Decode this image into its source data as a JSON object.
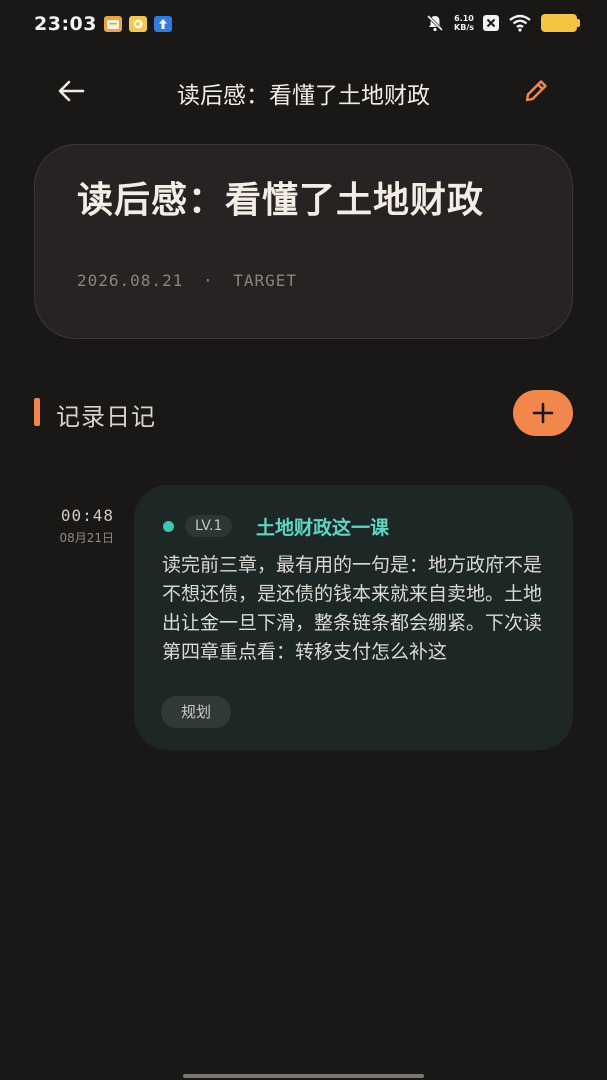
{
  "status_bar": {
    "time": "23:03",
    "net_speed_value": "6.10",
    "net_speed_unit": "KB/s",
    "icons": [
      "app-notif-orange",
      "app-notif-yellow",
      "app-notif-blue-upload",
      "mute-bell",
      "x-icon",
      "wifi",
      "battery"
    ],
    "battery_color": "#f5c542"
  },
  "app_bar": {
    "title": "读后感：看懂了土地财政",
    "back_icon": "arrow-left",
    "edit_icon": "pencil",
    "accent": "#f2874b"
  },
  "hero": {
    "title": "读后感：看懂了土地财政",
    "date": "2026.08.21",
    "separator": "·",
    "type": "TARGET"
  },
  "section": {
    "title": "记录日记",
    "add_icon": "plus",
    "accent": "#f2874b"
  },
  "entries": [
    {
      "time": "00:48",
      "date": "08月21日",
      "level": "LV.1",
      "title": "土地财政这一课",
      "body": "读完前三章，最有用的一句是：地方政府不是不想还债，是还债的钱本来就来自卖地。土地出让金一旦下滑，整条链条都会绷紧。下次读第四章重点看：转移支付怎么补这",
      "tag": "规划",
      "dot_color": "#3cc8b4",
      "title_color": "#5fd6c3"
    }
  ]
}
